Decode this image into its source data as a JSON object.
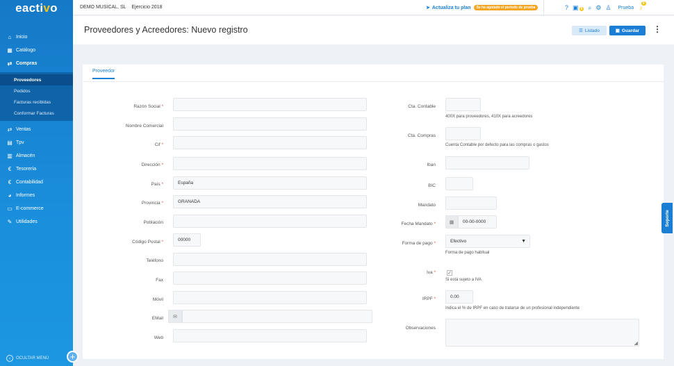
{
  "app": {
    "logo_text": "eacti",
    "logo_v": "v",
    "logo_o": "o"
  },
  "topbar": {
    "company": "DEMO MUSICAL, SL",
    "year": "Ejercicio 2018",
    "upgrade_label": "Actualiza tu plan",
    "upgrade_badge": "Se ha agotado el periodo de prueba",
    "notif_count": "0",
    "user": "Prueba",
    "bell_count": "0"
  },
  "sidebar": {
    "items": [
      {
        "label": "Inicio",
        "icon": "dashboard-icon"
      },
      {
        "label": "Catálogo",
        "icon": "catalog-icon"
      },
      {
        "label": "Compras",
        "icon": "shopping-icon"
      }
    ],
    "subitems": [
      {
        "label": "Proveedores"
      },
      {
        "label": "Pedidos"
      },
      {
        "label": "Facturas recibidas"
      },
      {
        "label": "Conformar Facturas"
      }
    ],
    "items2": [
      {
        "label": "Ventas"
      },
      {
        "label": "Tpv"
      },
      {
        "label": "Almacén"
      },
      {
        "label": "Tesorería"
      },
      {
        "label": "Contabilidad"
      },
      {
        "label": "Informes"
      },
      {
        "label": "E-commerce"
      },
      {
        "label": "Utilidades"
      }
    ],
    "hide_menu": "OCULTAR MENÚ"
  },
  "header": {
    "title": "Proveedores y Acreedores: Nuevo registro",
    "listado": "Listado",
    "guardar": "Guardar"
  },
  "tab": {
    "label": "Proveedor"
  },
  "form_left": {
    "razon_social": {
      "label": "Razón Social",
      "value": ""
    },
    "nombre_comercial": {
      "label": "Nombre Comercial",
      "value": ""
    },
    "cif": {
      "label": "Cif",
      "value": ""
    },
    "direccion": {
      "label": "Dirección",
      "value": ""
    },
    "pais": {
      "label": "País",
      "value": "España"
    },
    "provincia": {
      "label": "Provincia",
      "value": "GRANADA"
    },
    "poblacion": {
      "label": "Población",
      "value": ""
    },
    "codigo_postal": {
      "label": "Código Postal",
      "value": "00000"
    },
    "telefono": {
      "label": "Teléfono",
      "value": ""
    },
    "fax": {
      "label": "Fax",
      "value": ""
    },
    "movil": {
      "label": "Móvil",
      "value": ""
    },
    "email": {
      "label": "EMail",
      "value": ""
    },
    "web": {
      "label": "Web",
      "value": ""
    }
  },
  "form_right": {
    "cta_contable": {
      "label": "Cta. Contable",
      "value": "",
      "help": "400X para proveedores, 410X para acreedores"
    },
    "cta_compras": {
      "label": "Cta. Compras",
      "value": "",
      "help": "Cuenta Contable por defecto para las compras o gastos"
    },
    "iban": {
      "label": "Iban",
      "value": ""
    },
    "bic": {
      "label": "BIC",
      "value": ""
    },
    "mandato": {
      "label": "Mandato",
      "value": ""
    },
    "fecha_mandato": {
      "label": "Fecha Mandato",
      "value": "00-00-0000"
    },
    "forma_pago": {
      "label": "Forma de pago",
      "value": "Efectivo",
      "help": "Forma de pago habitual"
    },
    "iva": {
      "label": "Iva",
      "checked": true,
      "help": "Si está sujeto a IVA"
    },
    "irpf": {
      "label": "IRPF",
      "value": "0.00",
      "help": "Indica el % de IRPF en caso de tratarse de un profesional independiente"
    },
    "observaciones": {
      "label": "Observaciones",
      "value": ""
    }
  },
  "required_mark": "*",
  "soporte": "Soporte",
  "colors": {
    "primary": "#1a7fd4",
    "sidebar": "#1a8fdc",
    "accent": "#f5c518"
  }
}
